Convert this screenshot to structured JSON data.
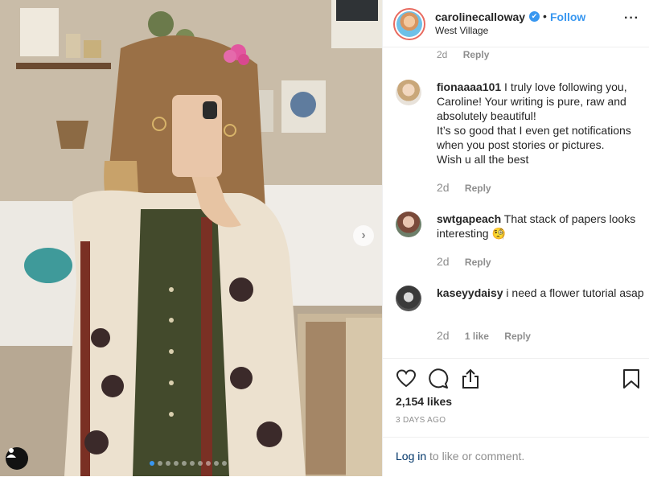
{
  "post": {
    "username": "carolinecalloway",
    "verified_mark": "✔",
    "separator": "•",
    "follow_label": "Follow",
    "location": "West Village",
    "more_label": "···",
    "next_arrow": "›",
    "carousel_count": 10,
    "carousel_active": 0
  },
  "comments": {
    "partial_time": "2d",
    "partial_reply": "Reply",
    "items": [
      {
        "username": "fionaaaa101",
        "text": " I truly love following you, Caroline! Your writing is pure, raw and absolutely beautiful!\nIt’s so good that I even get notifications when you post stories or pictures.\nWish u all the best",
        "time": "2d",
        "likes": "",
        "reply": "Reply"
      },
      {
        "username": "swtgapeach",
        "text": " That stack of papers looks interesting 🧐",
        "time": "2d",
        "likes": "",
        "reply": "Reply"
      },
      {
        "username": "kaseyydaisy",
        "text": " i need a flower tutorial asap",
        "time": "2d",
        "likes": "1 like",
        "reply": "Reply"
      }
    ]
  },
  "actions": {
    "likes": "2,154 likes",
    "time_ago": "3 DAYS AGO",
    "login_link": "Log in",
    "login_rest": " to like or comment."
  },
  "icons": [
    "heart-icon",
    "comment-icon",
    "share-icon",
    "bookmark-icon",
    "user-tag-icon",
    "chevron-right-icon",
    "more-icon",
    "verified-icon"
  ],
  "colors": {
    "link": "#3897f0",
    "muted": "#8e8e8e",
    "text": "#262626",
    "login": "#003569"
  }
}
